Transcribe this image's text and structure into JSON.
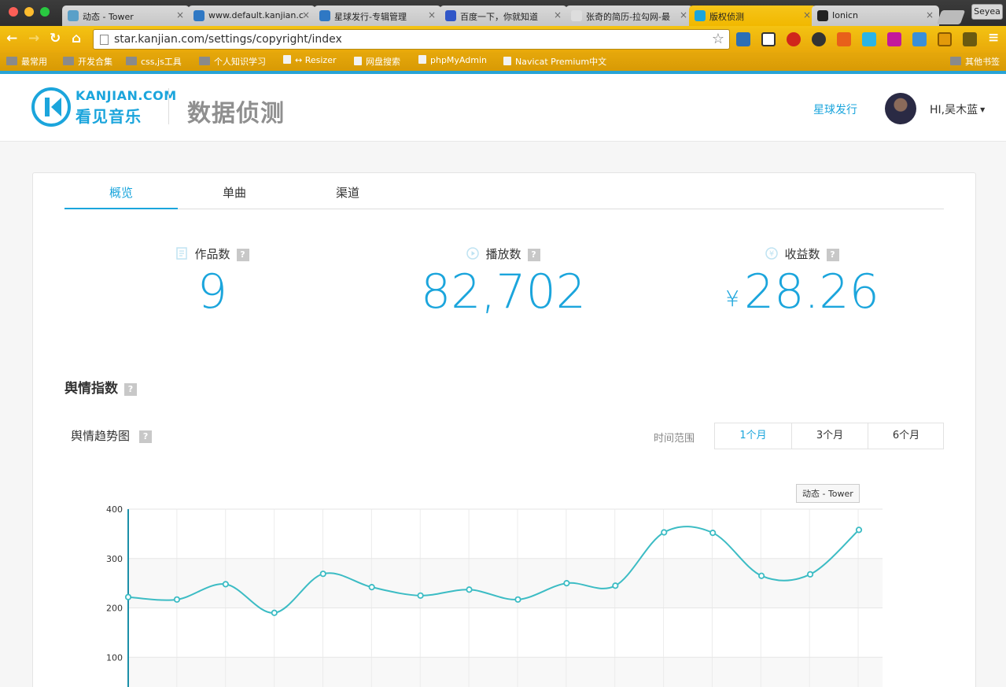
{
  "browser": {
    "tabs": [
      {
        "title": "动态 - Tower",
        "color": "#5aa0c8"
      },
      {
        "title": "www.default.kanjian.c",
        "color": "#2f78c4"
      },
      {
        "title": "星球发行-专辑管理",
        "color": "#2f78c4"
      },
      {
        "title": "百度一下，你就知道",
        "color": "#3056c8"
      },
      {
        "title": "张奇的简历-拉勾网-最",
        "color": "#dddddd"
      },
      {
        "title": "版权侦测",
        "color": "#1ba5dc",
        "active": true
      },
      {
        "title": "Ionicn",
        "color": "#222222"
      }
    ],
    "profile_name": "Seyea",
    "url": "star.kanjian.com/settings/copyright/index",
    "bookmarks": [
      {
        "label": "最常用",
        "icon": "folder-icon"
      },
      {
        "label": "开发合集",
        "icon": "folder-icon"
      },
      {
        "label": "css,js工具",
        "icon": "folder-icon"
      },
      {
        "label": "个人知识学习",
        "icon": "folder-icon"
      },
      {
        "label": "↔ Resizer",
        "icon": "page-icon"
      },
      {
        "label": "网盘搜索",
        "icon": "search-icon"
      },
      {
        "label": "phpMyAdmin",
        "icon": "db-icon"
      },
      {
        "label": "Navicat Premium中文",
        "icon": "app-icon"
      },
      {
        "label": "其他书签",
        "icon": "folder-icon"
      }
    ],
    "tooltip": "动态 - Tower"
  },
  "header": {
    "logo_en": "KANJIAN.COM",
    "logo_cn": "看见音乐",
    "title": "数据侦测",
    "nav_link": "星球发行",
    "user": "HI,吴木蓝"
  },
  "tabs": [
    {
      "label": "概览",
      "active": true
    },
    {
      "label": "单曲"
    },
    {
      "label": "渠道"
    }
  ],
  "stats": [
    {
      "label": "作品数",
      "value": "9",
      "icon": "document-icon"
    },
    {
      "label": "播放数",
      "value": "82,702",
      "icon": "play-icon"
    },
    {
      "label": "收益数",
      "value": "28.26",
      "currency": "¥",
      "icon": "yen-icon"
    }
  ],
  "help_glyph": "?",
  "section": {
    "title": "舆情指数"
  },
  "chart_card": {
    "title": "舆情趋势图",
    "range_label": "时间范围",
    "ranges": [
      "1个月",
      "3个月",
      "6个月"
    ],
    "selected_range": "1个月"
  },
  "chart_data": {
    "type": "line",
    "ylim": [
      0,
      400
    ],
    "yticks": [
      "400",
      "300",
      "200",
      "100"
    ],
    "values": [
      222,
      217,
      248,
      190,
      269,
      242,
      225,
      237,
      217,
      250,
      245,
      353,
      352,
      265,
      268,
      358
    ],
    "line_color": "#3cbcc4",
    "smooth": true
  }
}
